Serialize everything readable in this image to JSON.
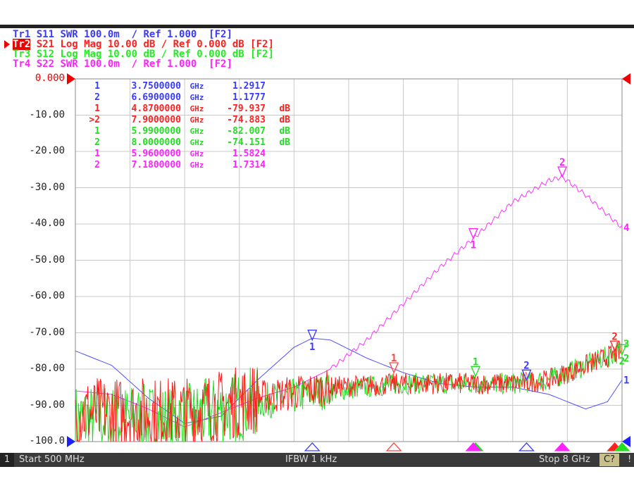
{
  "traces": [
    {
      "label": "Tr1",
      "text": "S11 SWR 100.0m  / Ref 1.000  [F2]",
      "color": "#3a3aff",
      "active": false
    },
    {
      "label": "Tr2",
      "text": "S21 Log Mag 10.00 dB / Ref 0.000 dB [F2]",
      "color": "#ff2020",
      "active": true
    },
    {
      "label": "Tr3",
      "text": "S12 Log Mag 10.00 dB / Ref 0.000 dB [F2]",
      "color": "#22ee22",
      "active": false
    },
    {
      "label": "Tr4",
      "text": "S22 SWR 100.0m  / Ref 1.000  [F2]",
      "color": "#ff22ff",
      "active": false
    }
  ],
  "markers_table": [
    {
      "id": "1",
      "freq": "3.7500000",
      "unit": "GHz",
      "value": "1.2917",
      "vunit": "",
      "color": "#3a3aff"
    },
    {
      "id": "2",
      "freq": "6.6900000",
      "unit": "GHz",
      "value": "1.1777",
      "vunit": "",
      "color": "#3a3aff"
    },
    {
      "id": "1",
      "freq": "4.8700000",
      "unit": "GHz",
      "value": "-79.937",
      "vunit": "dB",
      "color": "#ff2020"
    },
    {
      "id": ">2",
      "freq": "7.9000000",
      "unit": "GHz",
      "value": "-74.883",
      "vunit": "dB",
      "color": "#ff2020"
    },
    {
      "id": "1",
      "freq": "5.9900000",
      "unit": "GHz",
      "value": "-82.007",
      "vunit": "dB",
      "color": "#22dd22"
    },
    {
      "id": "2",
      "freq": "8.0000000",
      "unit": "GHz",
      "value": "-74.151",
      "vunit": "dB",
      "color": "#22dd22"
    },
    {
      "id": "1",
      "freq": "5.9600000",
      "unit": "GHz",
      "value": "1.5824",
      "vunit": "",
      "color": "#ff22ff"
    },
    {
      "id": "2",
      "freq": "7.1800000",
      "unit": "GHz",
      "value": "1.7314",
      "vunit": "",
      "color": "#ff22ff"
    }
  ],
  "chart_data": {
    "type": "line",
    "xlim": [
      0.5,
      8
    ],
    "ylim": [
      -100,
      0
    ],
    "x_divisions": 10,
    "yticks": [
      "0.000",
      "-10.00",
      "-20.00",
      "-30.00",
      "-40.00",
      "-50.00",
      "-60.00",
      "-70.00",
      "-80.00",
      "-90.00",
      "-100.0"
    ],
    "grid": true,
    "series": [
      {
        "trace": "Tr1",
        "color": "#5050ff",
        "noisy": false,
        "x": [
          0.5,
          1.0,
          1.5,
          2.0,
          2.5,
          3.0,
          3.5,
          3.75,
          4.0,
          4.5,
          5.0,
          5.5,
          6.0,
          6.5,
          7.0,
          7.5,
          7.8,
          8.0
        ],
        "y": [
          -75,
          -79,
          -88,
          -95,
          -93,
          -83,
          -74,
          -71.5,
          -72,
          -77,
          -81,
          -84,
          -85,
          -85,
          -87,
          -91,
          -89,
          -83
        ]
      },
      {
        "trace": "Tr4",
        "color": "#ff33ff",
        "noisy": false,
        "x": [
          0.5,
          1.0,
          1.5,
          2.0,
          2.5,
          3.0,
          3.5,
          4.0,
          4.5,
          5.0,
          5.5,
          5.96,
          6.5,
          7.0,
          7.18,
          7.5,
          8.0
        ],
        "y": [
          -86,
          -87,
          -91,
          -96,
          -92,
          -88,
          -85,
          -80,
          -72,
          -62,
          -52,
          -44,
          -34,
          -28,
          -27,
          -32,
          -41
        ]
      },
      {
        "trace": "Tr3",
        "color": "#22dd22",
        "noisy": true,
        "x": [
          0.5,
          2.0,
          3.0,
          4.0,
          5.0,
          6.0,
          6.5,
          7.0,
          7.5,
          8.0
        ],
        "y": [
          -94,
          -94,
          -89,
          -86,
          -84,
          -84,
          -84,
          -83,
          -79,
          -75
        ]
      },
      {
        "trace": "Tr2",
        "color": "#ff1a1a",
        "noisy": true,
        "x": [
          0.5,
          2.0,
          3.0,
          4.0,
          5.0,
          6.0,
          6.5,
          7.0,
          7.5,
          8.0
        ],
        "y": [
          -92,
          -92,
          -88,
          -85,
          -84,
          -84,
          -84,
          -83,
          -79,
          -75
        ]
      }
    ],
    "markers": [
      {
        "id": "1",
        "trace": "Tr1",
        "x": 3.75,
        "y": -72,
        "color": "#3a3aff",
        "label_below": true
      },
      {
        "id": "2",
        "trace": "Tr1",
        "x": 6.69,
        "y": -83,
        "color": "#3a3aff",
        "label_below": false
      },
      {
        "id": "1",
        "trace": "Tr2",
        "x": 4.87,
        "y": -81,
        "color": "#ff4040",
        "label_below": false
      },
      {
        "id": "2",
        "trace": "Tr2",
        "x": 7.9,
        "y": -75,
        "color": "#ff2020",
        "label_below": false
      },
      {
        "id": "1",
        "trace": "Tr3",
        "x": 5.99,
        "y": -82,
        "color": "#22dd22",
        "label_below": false
      },
      {
        "id": "2",
        "trace": "Tr3",
        "x": 8.0,
        "y": -76,
        "color": "#22dd22",
        "label_below": true
      },
      {
        "id": "1",
        "trace": "Tr4",
        "x": 5.96,
        "y": -44,
        "color": "#ff22ff",
        "label_below": true
      },
      {
        "id": "2",
        "trace": "Tr4",
        "x": 7.18,
        "y": -27,
        "color": "#ff22ff",
        "label_below": false
      }
    ],
    "end_labels": [
      {
        "text": "1",
        "color": "#3a3aff",
        "y": -83
      },
      {
        "text": "4",
        "color": "#ff22ff",
        "y": -41
      },
      {
        "text": "3",
        "color": "#22dd22",
        "y": -73
      },
      {
        "text": "2",
        "color": "#22dd22",
        "y": -77
      }
    ]
  },
  "status": {
    "channel": "1",
    "start": "Start 500 MHz",
    "ifbw": "IFBW 1 kHz",
    "stop": "Stop 8 GHz",
    "cal": "C?",
    "flag": "!"
  }
}
